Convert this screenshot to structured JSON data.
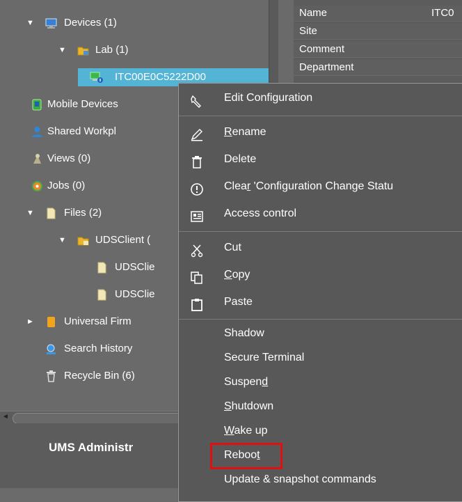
{
  "tree": {
    "items": [
      {
        "label": "Devices (1)",
        "arrow": "▼",
        "icon": "monitor-icon"
      },
      {
        "label": "Lab (1)",
        "arrow": "▼",
        "icon": "folder-icon"
      },
      {
        "label": "ITC00E0C5222D00",
        "arrow": "",
        "icon": "device-icon"
      },
      {
        "label": "Mobile Devices",
        "arrow": "",
        "icon": "mobile-devices-icon"
      },
      {
        "label": "Shared Workpl",
        "arrow": "",
        "icon": "user-icon"
      },
      {
        "label": "Views (0)",
        "arrow": "",
        "icon": "views-icon"
      },
      {
        "label": "Jobs (0)",
        "arrow": "",
        "icon": "jobs-icon"
      },
      {
        "label": "Files (2)",
        "arrow": "▼",
        "icon": "file-icon"
      },
      {
        "label": "UDSClient (",
        "arrow": "▼",
        "icon": "folder-icon"
      },
      {
        "label": "UDSClie",
        "arrow": "",
        "icon": "file-icon"
      },
      {
        "label": "UDSClie",
        "arrow": "",
        "icon": "file-icon"
      },
      {
        "label": "Universal Firm",
        "arrow": "►",
        "icon": "firmware-icon"
      },
      {
        "label": "Search History",
        "arrow": "",
        "icon": "search-icon"
      },
      {
        "label": "Recycle Bin (6)",
        "arrow": "",
        "icon": "trash-icon"
      }
    ]
  },
  "footer": {
    "title": "UMS Administr"
  },
  "properties": {
    "rows": [
      {
        "key": "Name",
        "value": "ITC0"
      },
      {
        "key": "Site",
        "value": ""
      },
      {
        "key": "Comment",
        "value": ""
      },
      {
        "key": "Department",
        "value": ""
      }
    ]
  },
  "context_menu": {
    "edit_configuration": {
      "pre": "Edit Confi",
      "u": "g",
      "post": "uration",
      "icon": "wrench-icon"
    },
    "rename": {
      "pre": "",
      "u": "R",
      "post": "ename",
      "icon": "pencil-icon"
    },
    "delete": {
      "pre": "Delete",
      "u": "",
      "post": "",
      "icon": "trash-icon"
    },
    "clear_status": {
      "pre": "Clea",
      "u": "r",
      "post": " 'Configuration Change Statu",
      "icon": "exclamation-icon"
    },
    "access_control": {
      "pre": "Access control",
      "u": "",
      "post": "",
      "icon": "access-control-icon"
    },
    "cut": {
      "pre": "Cut",
      "u": "",
      "post": "",
      "icon": "scissors-icon"
    },
    "copy": {
      "pre": "",
      "u": "C",
      "post": "opy",
      "icon": "copy-icon"
    },
    "paste": {
      "pre": "Paste",
      "u": "",
      "post": "",
      "icon": "paste-icon"
    },
    "shadow": {
      "pre": "Shadow",
      "u": "",
      "post": ""
    },
    "secure_terminal": {
      "pre": "Secure Terminal",
      "u": "",
      "post": ""
    },
    "suspend": {
      "pre": "Suspen",
      "u": "d",
      "post": ""
    },
    "shutdown": {
      "pre": "",
      "u": "S",
      "post": "hutdown"
    },
    "wake_up": {
      "pre": "",
      "u": "W",
      "post": "ake up"
    },
    "reboot": {
      "pre": "Reboo",
      "u": "t",
      "post": ""
    },
    "update_snapshot": {
      "pre": "Update & snapshot commands",
      "u": "",
      "post": ""
    }
  },
  "colors": {
    "selection": "#53b4d6",
    "highlight_border": "#e01010",
    "menu_bg": "#585858",
    "panel_bg": "#6a6a6a"
  }
}
